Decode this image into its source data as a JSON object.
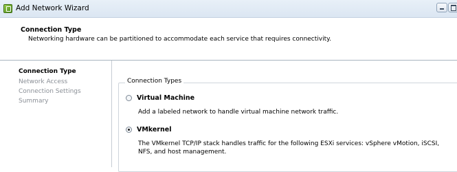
{
  "window": {
    "title": "Add Network Wizard",
    "minimize_icon": "minimize-icon",
    "maximize_icon": "maximize-icon"
  },
  "header": {
    "title": "Connection Type",
    "subtitle": "Networking hardware can be partitioned to accommodate each service that requires connectivity."
  },
  "steps": [
    {
      "label": "Connection Type",
      "active": true
    },
    {
      "label": "Network Access",
      "active": false
    },
    {
      "label": "Connection Settings",
      "active": false
    },
    {
      "label": "Summary",
      "active": false
    }
  ],
  "connection_types": {
    "legend": "Connection Types",
    "options": [
      {
        "label": "Virtual Machine",
        "description": "Add a labeled network to handle virtual machine network traffic.",
        "selected": false
      },
      {
        "label": "VMkernel",
        "description": "The VMkernel TCP/IP stack handles traffic for the following ESXi services: vSphere vMotion, iSCSI, NFS, and host management.",
        "selected": true
      }
    ]
  }
}
